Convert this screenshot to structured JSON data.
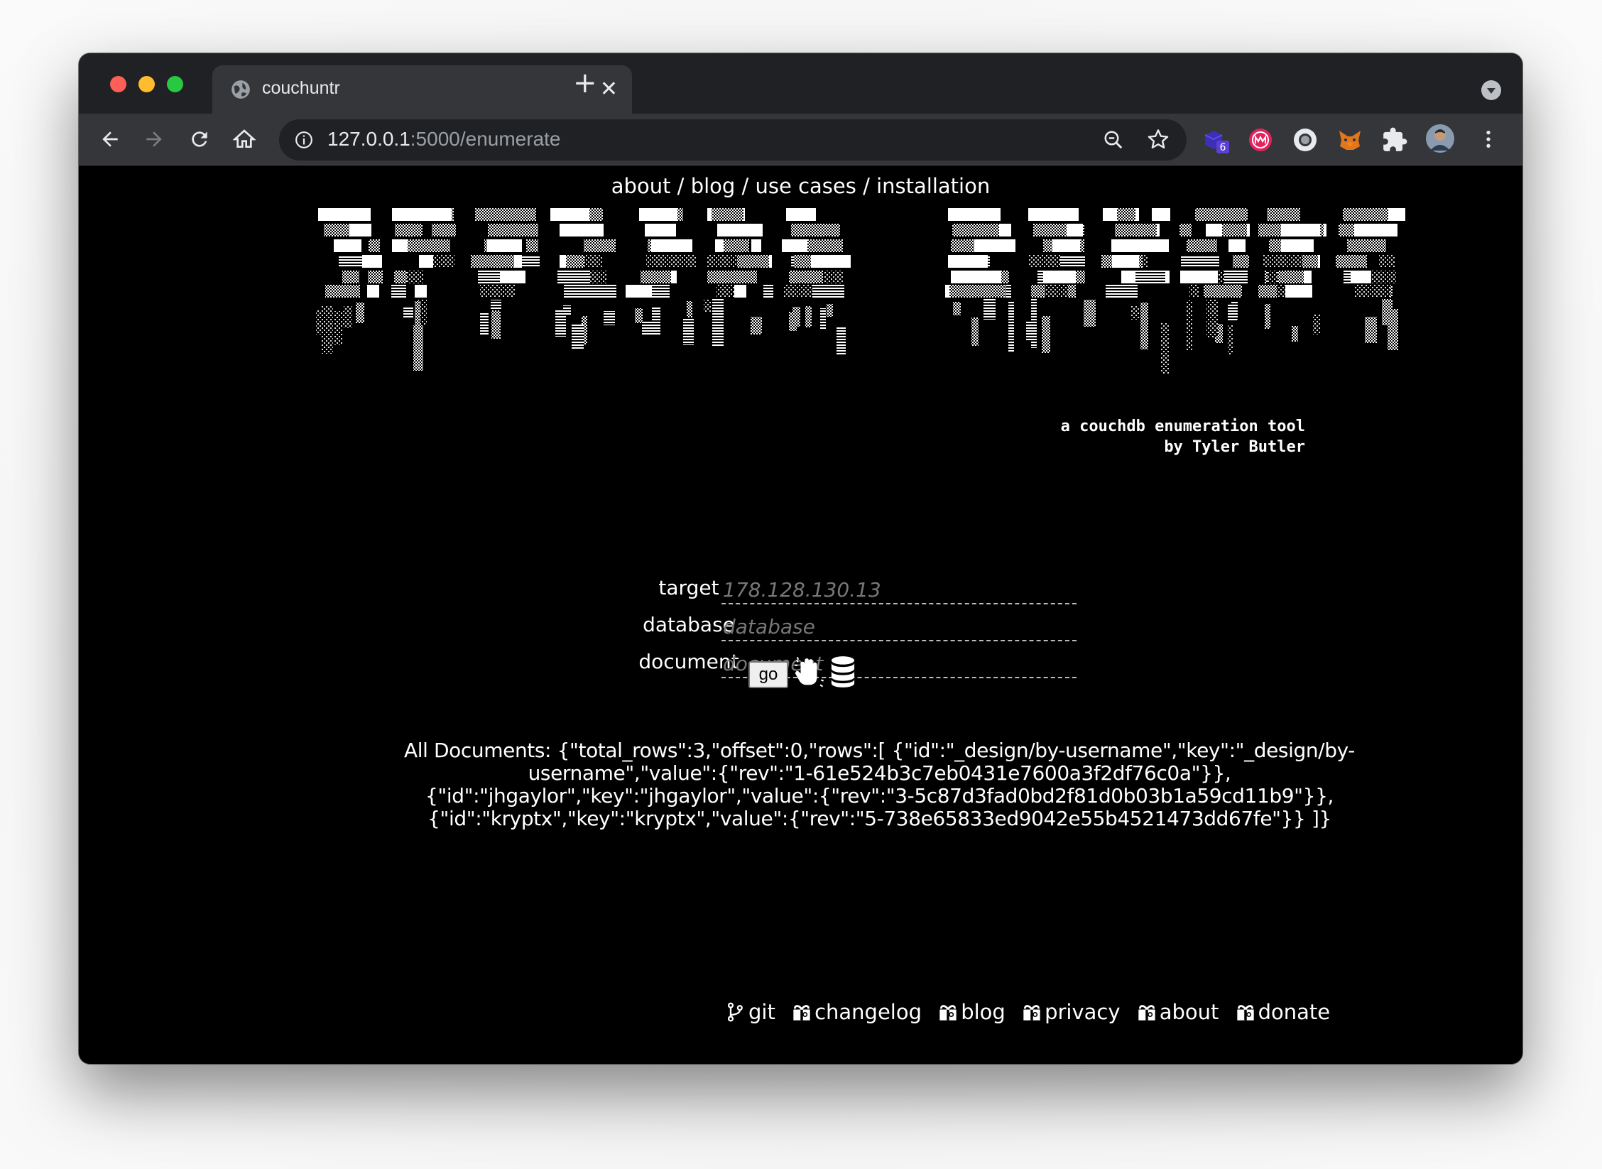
{
  "browser": {
    "tab_title": "couchuntr",
    "url_host": "127.0.0.1",
    "url_rest": ":5000/enumerate",
    "extension_badge": "6"
  },
  "nav": {
    "about": "about",
    "blog": "blog",
    "use_cases": "use cases",
    "installation": "installation",
    "separator": " / "
  },
  "logo": {
    "text": "COUCHDB HUNTR"
  },
  "tagline": {
    "line1": "a couchdb enumeration tool",
    "line2": "by Tyler Butler"
  },
  "form": {
    "target_label": "target",
    "target_placeholder": "178.128.130.13",
    "database_label": "database",
    "database_placeholder": "database",
    "document_label": "document",
    "document_placeholder": "document",
    "go_label": "go"
  },
  "result": {
    "line1": "All Documents: {\"total_rows\":3,\"offset\":0,\"rows\":[ {\"id\":\"_design/by-username\",\"key\":\"_design/by-",
    "line2": "username\",\"value\":{\"rev\":\"1-61e524b3c7eb0431e7600a3f2df76c0a\"}},",
    "line3": "{\"id\":\"jhgaylor\",\"key\":\"jhgaylor\",\"value\":{\"rev\":\"3-5c87d3fad0bd2f81d0b03b1a59cd11b9\"}},",
    "line4": "{\"id\":\"kryptx\",\"key\":\"kryptx\",\"value\":{\"rev\":\"5-738e65833ed9042e55b4521473dd67fe\"}} ]}"
  },
  "footer": {
    "git": "git",
    "changelog": "changelog",
    "blog": "blog",
    "privacy": "privacy",
    "about": "about",
    "donate": "donate"
  },
  "colors": {
    "page_bg": "#000000",
    "text": "#ffffff",
    "tab_bar": "#202124",
    "toolbar": "#35363a"
  }
}
